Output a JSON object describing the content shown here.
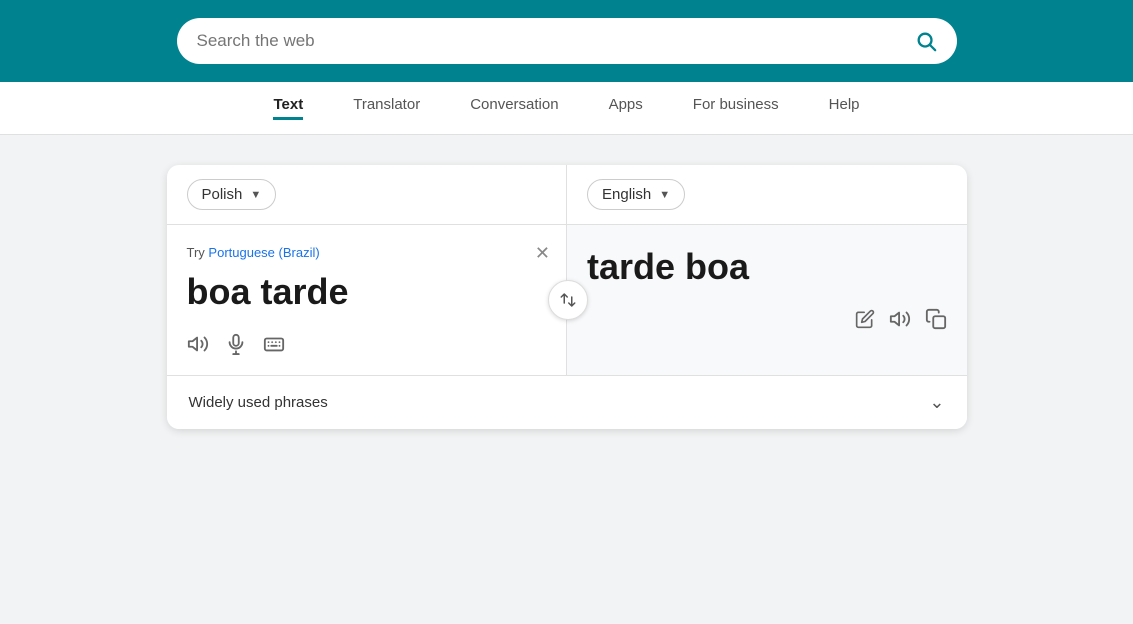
{
  "header": {
    "search_placeholder": "Search the web",
    "bg_color": "#00838f"
  },
  "nav": {
    "items": [
      {
        "label": "Text",
        "active": true
      },
      {
        "label": "Translator",
        "active": false
      },
      {
        "label": "Conversation",
        "active": false
      },
      {
        "label": "Apps",
        "active": false
      },
      {
        "label": "For business",
        "active": false
      },
      {
        "label": "Help",
        "active": false
      }
    ]
  },
  "translator": {
    "source_lang": "Polish",
    "target_lang": "English",
    "try_label": "Try",
    "try_suggestion": "Portuguese (Brazil)",
    "input_text": "boa tarde",
    "output_text": "tarde boa",
    "phrases_label": "Widely used phrases"
  }
}
